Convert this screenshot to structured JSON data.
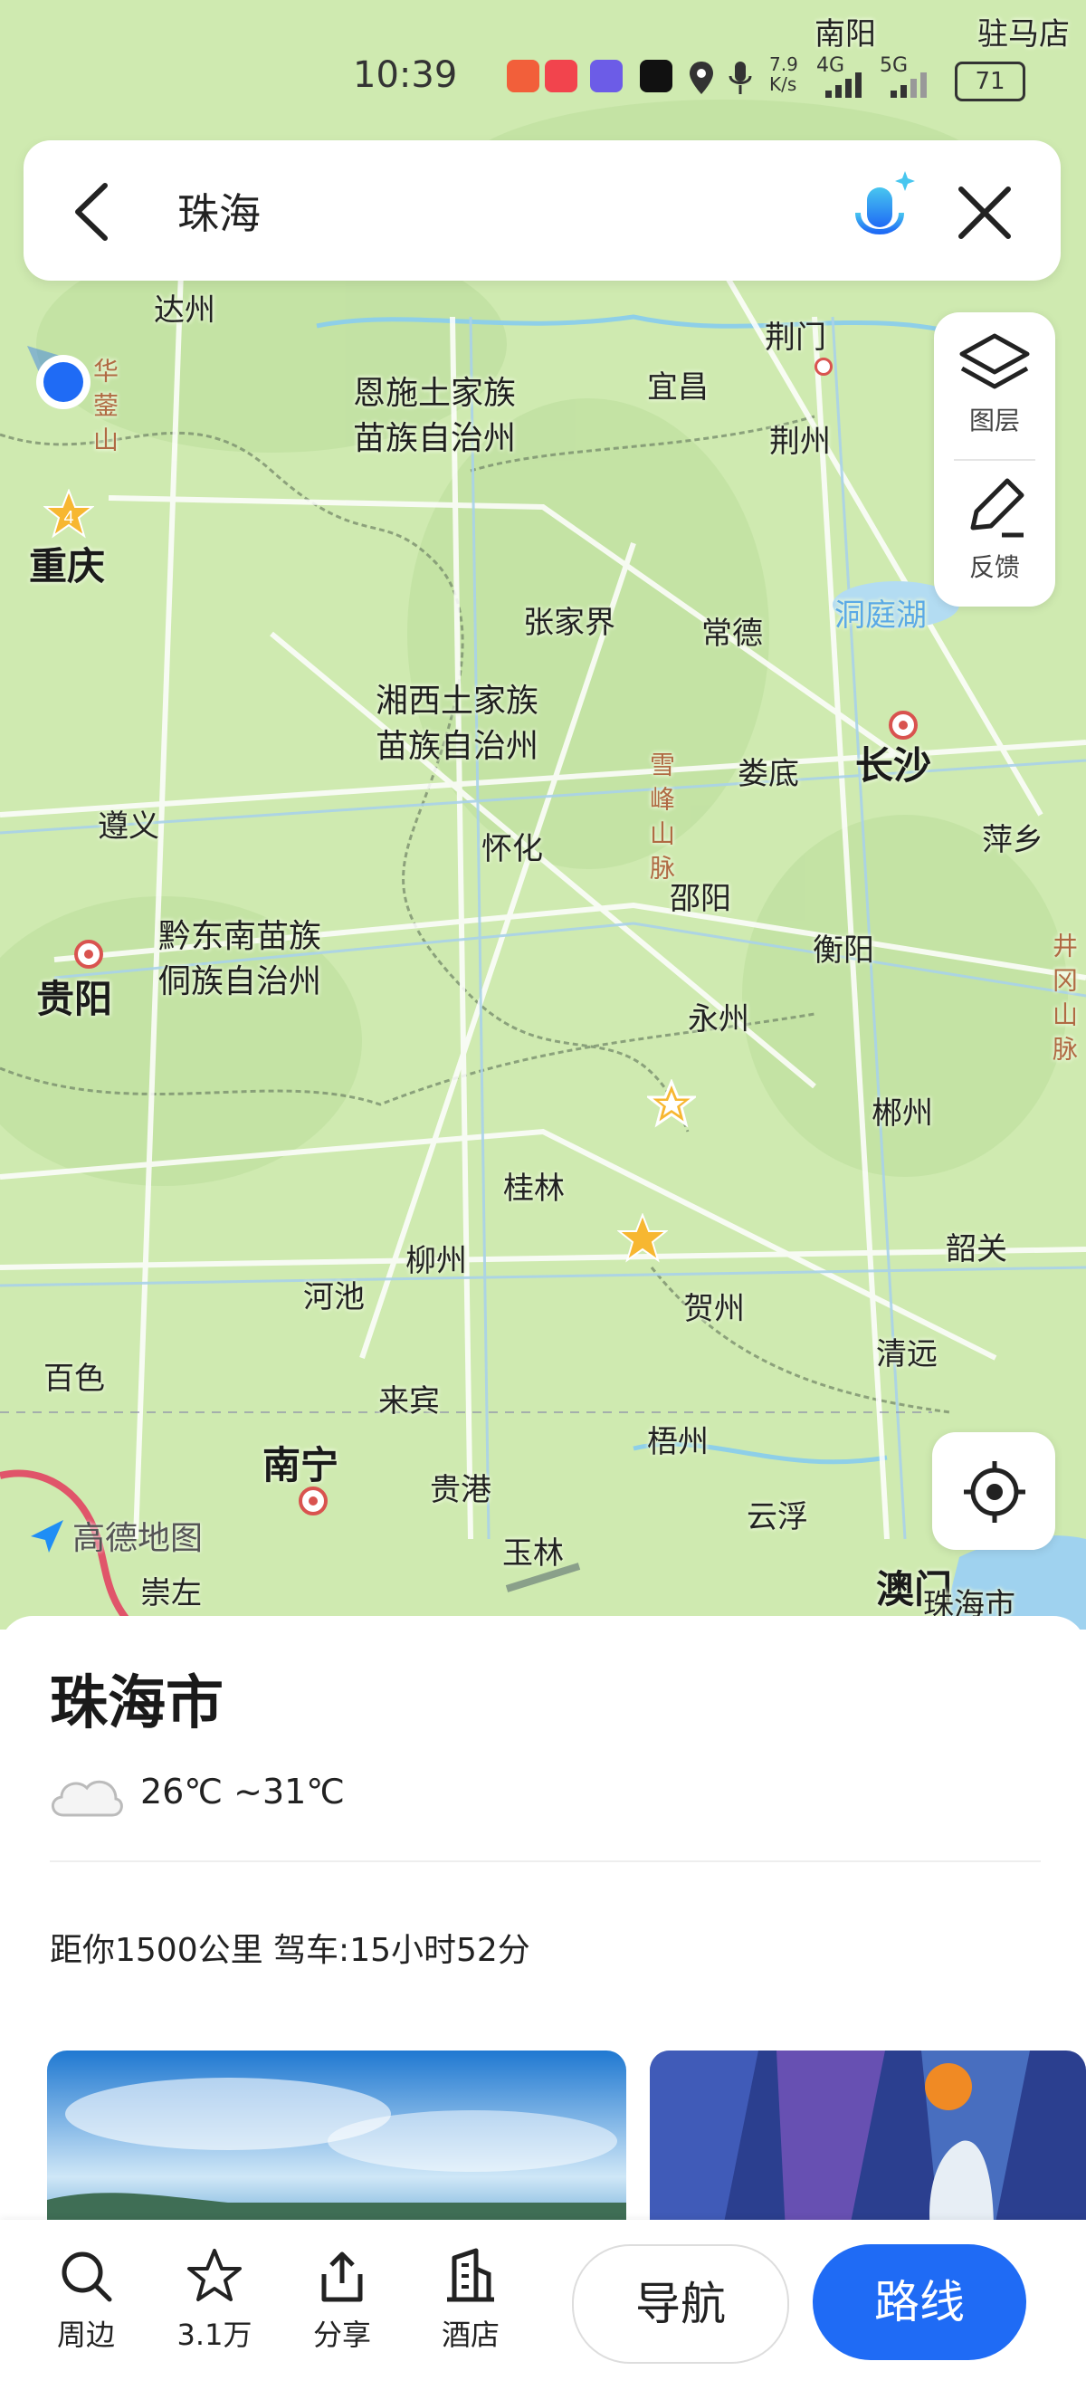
{
  "status_bar": {
    "time": "10:39",
    "net_speed": "7.9 K/s",
    "signal_1": "4G",
    "signal_2": "5G",
    "battery": "71"
  },
  "search": {
    "query": "珠海"
  },
  "map_controls": {
    "layers_label": "图层",
    "feedback_label": "反馈"
  },
  "map_labels": {
    "top_cities": [
      "南阳",
      "驻马店"
    ],
    "nanyang": "南阳",
    "zhumadian": "驻马店",
    "dazhou": "达州",
    "jingmen": "荆门",
    "yichang": "宜昌",
    "jingzhou": "荆州",
    "enshi": "恩施土家族\n苗族自治州",
    "chongqing": "重庆",
    "chongqing_badge": "4",
    "zhangjiajie": "张家界",
    "changde": "常德",
    "dongting": "洞庭湖",
    "xiangxi": "湘西土家族\n苗族自治州",
    "loudi": "娄底",
    "changsha": "长沙",
    "zunyi": "遵义",
    "huaihua": "怀化",
    "shaoyang": "邵阳",
    "pingxiang": "萍乡",
    "guiyang": "贵阳",
    "qiandongnan": "黔东南苗族\n侗族自治州",
    "hengyang": "衡阳",
    "yongzhou": "永州",
    "chenzhou": "郴州",
    "guilin": "桂林",
    "liuzhou": "柳州",
    "hechi": "河池",
    "hezhou": "贺州",
    "shaoguan": "韶关",
    "baise": "百色",
    "laibin": "来宾",
    "qingyuan": "清远",
    "wuzhou": "梧州",
    "nanning": "南宁",
    "guigang": "贵港",
    "yunfu": "云浮",
    "yulin": "玉林",
    "chongzuo": "崇左",
    "macau": "澳门",
    "zhuhai": "珠海市",
    "xuefeng_mtn": "雪峰山脉",
    "jinggang_mtn": "井冈山脉",
    "huaying_mtn": "华蓥山",
    "brand": "高德地图"
  },
  "place": {
    "name": "珠海市",
    "weather": "26℃ ~31℃",
    "distance": "距你1500公里 驾车:15小时52分"
  },
  "bottom_bar": {
    "nearby": "周边",
    "favorites": "3.1万",
    "share": "分享",
    "hotel": "酒店",
    "navigate": "导航",
    "route": "路线"
  },
  "colors": {
    "map_land": "#cfeab0",
    "route_blue": "#1f6bf5",
    "city_red": "#d9534f"
  }
}
